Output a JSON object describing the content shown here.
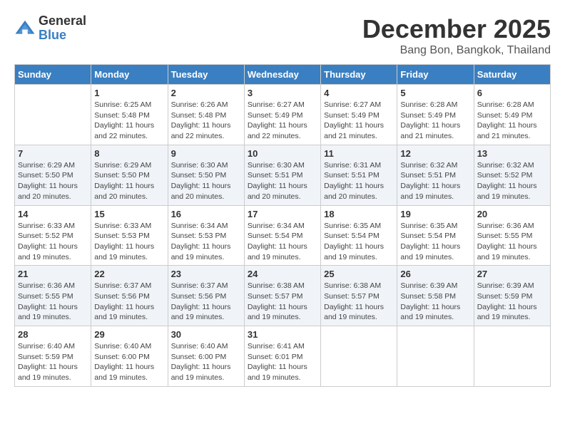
{
  "header": {
    "logo_general": "General",
    "logo_blue": "Blue",
    "main_title": "December 2025",
    "sub_title": "Bang Bon, Bangkok, Thailand"
  },
  "calendar": {
    "days_of_week": [
      "Sunday",
      "Monday",
      "Tuesday",
      "Wednesday",
      "Thursday",
      "Friday",
      "Saturday"
    ],
    "weeks": [
      [
        {
          "day": "",
          "sunrise": "",
          "sunset": "",
          "daylight": ""
        },
        {
          "day": "1",
          "sunrise": "Sunrise: 6:25 AM",
          "sunset": "Sunset: 5:48 PM",
          "daylight": "Daylight: 11 hours and 22 minutes."
        },
        {
          "day": "2",
          "sunrise": "Sunrise: 6:26 AM",
          "sunset": "Sunset: 5:48 PM",
          "daylight": "Daylight: 11 hours and 22 minutes."
        },
        {
          "day": "3",
          "sunrise": "Sunrise: 6:27 AM",
          "sunset": "Sunset: 5:49 PM",
          "daylight": "Daylight: 11 hours and 22 minutes."
        },
        {
          "day": "4",
          "sunrise": "Sunrise: 6:27 AM",
          "sunset": "Sunset: 5:49 PM",
          "daylight": "Daylight: 11 hours and 21 minutes."
        },
        {
          "day": "5",
          "sunrise": "Sunrise: 6:28 AM",
          "sunset": "Sunset: 5:49 PM",
          "daylight": "Daylight: 11 hours and 21 minutes."
        },
        {
          "day": "6",
          "sunrise": "Sunrise: 6:28 AM",
          "sunset": "Sunset: 5:49 PM",
          "daylight": "Daylight: 11 hours and 21 minutes."
        }
      ],
      [
        {
          "day": "7",
          "sunrise": "Sunrise: 6:29 AM",
          "sunset": "Sunset: 5:50 PM",
          "daylight": "Daylight: 11 hours and 20 minutes."
        },
        {
          "day": "8",
          "sunrise": "Sunrise: 6:29 AM",
          "sunset": "Sunset: 5:50 PM",
          "daylight": "Daylight: 11 hours and 20 minutes."
        },
        {
          "day": "9",
          "sunrise": "Sunrise: 6:30 AM",
          "sunset": "Sunset: 5:50 PM",
          "daylight": "Daylight: 11 hours and 20 minutes."
        },
        {
          "day": "10",
          "sunrise": "Sunrise: 6:30 AM",
          "sunset": "Sunset: 5:51 PM",
          "daylight": "Daylight: 11 hours and 20 minutes."
        },
        {
          "day": "11",
          "sunrise": "Sunrise: 6:31 AM",
          "sunset": "Sunset: 5:51 PM",
          "daylight": "Daylight: 11 hours and 20 minutes."
        },
        {
          "day": "12",
          "sunrise": "Sunrise: 6:32 AM",
          "sunset": "Sunset: 5:51 PM",
          "daylight": "Daylight: 11 hours and 19 minutes."
        },
        {
          "day": "13",
          "sunrise": "Sunrise: 6:32 AM",
          "sunset": "Sunset: 5:52 PM",
          "daylight": "Daylight: 11 hours and 19 minutes."
        }
      ],
      [
        {
          "day": "14",
          "sunrise": "Sunrise: 6:33 AM",
          "sunset": "Sunset: 5:52 PM",
          "daylight": "Daylight: 11 hours and 19 minutes."
        },
        {
          "day": "15",
          "sunrise": "Sunrise: 6:33 AM",
          "sunset": "Sunset: 5:53 PM",
          "daylight": "Daylight: 11 hours and 19 minutes."
        },
        {
          "day": "16",
          "sunrise": "Sunrise: 6:34 AM",
          "sunset": "Sunset: 5:53 PM",
          "daylight": "Daylight: 11 hours and 19 minutes."
        },
        {
          "day": "17",
          "sunrise": "Sunrise: 6:34 AM",
          "sunset": "Sunset: 5:54 PM",
          "daylight": "Daylight: 11 hours and 19 minutes."
        },
        {
          "day": "18",
          "sunrise": "Sunrise: 6:35 AM",
          "sunset": "Sunset: 5:54 PM",
          "daylight": "Daylight: 11 hours and 19 minutes."
        },
        {
          "day": "19",
          "sunrise": "Sunrise: 6:35 AM",
          "sunset": "Sunset: 5:54 PM",
          "daylight": "Daylight: 11 hours and 19 minutes."
        },
        {
          "day": "20",
          "sunrise": "Sunrise: 6:36 AM",
          "sunset": "Sunset: 5:55 PM",
          "daylight": "Daylight: 11 hours and 19 minutes."
        }
      ],
      [
        {
          "day": "21",
          "sunrise": "Sunrise: 6:36 AM",
          "sunset": "Sunset: 5:55 PM",
          "daylight": "Daylight: 11 hours and 19 minutes."
        },
        {
          "day": "22",
          "sunrise": "Sunrise: 6:37 AM",
          "sunset": "Sunset: 5:56 PM",
          "daylight": "Daylight: 11 hours and 19 minutes."
        },
        {
          "day": "23",
          "sunrise": "Sunrise: 6:37 AM",
          "sunset": "Sunset: 5:56 PM",
          "daylight": "Daylight: 11 hours and 19 minutes."
        },
        {
          "day": "24",
          "sunrise": "Sunrise: 6:38 AM",
          "sunset": "Sunset: 5:57 PM",
          "daylight": "Daylight: 11 hours and 19 minutes."
        },
        {
          "day": "25",
          "sunrise": "Sunrise: 6:38 AM",
          "sunset": "Sunset: 5:57 PM",
          "daylight": "Daylight: 11 hours and 19 minutes."
        },
        {
          "day": "26",
          "sunrise": "Sunrise: 6:39 AM",
          "sunset": "Sunset: 5:58 PM",
          "daylight": "Daylight: 11 hours and 19 minutes."
        },
        {
          "day": "27",
          "sunrise": "Sunrise: 6:39 AM",
          "sunset": "Sunset: 5:59 PM",
          "daylight": "Daylight: 11 hours and 19 minutes."
        }
      ],
      [
        {
          "day": "28",
          "sunrise": "Sunrise: 6:40 AM",
          "sunset": "Sunset: 5:59 PM",
          "daylight": "Daylight: 11 hours and 19 minutes."
        },
        {
          "day": "29",
          "sunrise": "Sunrise: 6:40 AM",
          "sunset": "Sunset: 6:00 PM",
          "daylight": "Daylight: 11 hours and 19 minutes."
        },
        {
          "day": "30",
          "sunrise": "Sunrise: 6:40 AM",
          "sunset": "Sunset: 6:00 PM",
          "daylight": "Daylight: 11 hours and 19 minutes."
        },
        {
          "day": "31",
          "sunrise": "Sunrise: 6:41 AM",
          "sunset": "Sunset: 6:01 PM",
          "daylight": "Daylight: 11 hours and 19 minutes."
        },
        {
          "day": "",
          "sunrise": "",
          "sunset": "",
          "daylight": ""
        },
        {
          "day": "",
          "sunrise": "",
          "sunset": "",
          "daylight": ""
        },
        {
          "day": "",
          "sunrise": "",
          "sunset": "",
          "daylight": ""
        }
      ]
    ]
  }
}
